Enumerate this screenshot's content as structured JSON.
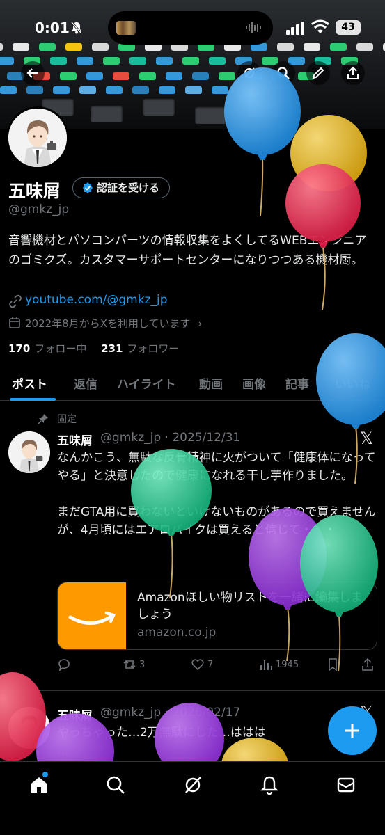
{
  "status_bar": {
    "time": "0:01",
    "battery": "43"
  },
  "header_actions": {
    "back_icon": "arrow-left-icon",
    "grok_icon": "grok-icon",
    "search_icon": "search-icon",
    "edit_icon": "pen-icon",
    "share_icon": "share-icon"
  },
  "profile": {
    "name": "五味屑",
    "verify_button": "認証を受ける",
    "handle": "@gmkz_jp",
    "bio": "音響機材とパソコンパーツの情報収集をよくしてるWEBエンジニアのゴミクズ。カスタマーサポートセンターになりつつある機材厨。",
    "link": "youtube.com/@gmkz_jp",
    "joined": "2022年8月からXを利用しています",
    "following_count": "170",
    "following_label": "フォロー中",
    "followers_count": "231",
    "followers_label": "フォロワー"
  },
  "tabs": [
    "ポスト",
    "返信",
    "ハイライト",
    "動画",
    "画像",
    "記事",
    "いいね"
  ],
  "posts": [
    {
      "pinned_label": "固定",
      "name": "五味屑",
      "handle": "@gmkz_jp",
      "date": "2025/12/31",
      "text": "なんかこう、無駄な反骨精神に火がついて「健康体になってやる」と決意したので健康になれる干し芋作りました。\n\nまだGTA用に買わないといけないものがあるので買えませんが、4月頃にはエアロバイクは買えると信じて・・・",
      "card": {
        "title": "Amazonほしい物リストを一緒に編集しましょう",
        "domain": "amazon.co.jp"
      },
      "stats": {
        "replies": "",
        "reposts": "3",
        "likes": "7",
        "views": "1945"
      }
    },
    {
      "name": "五味屑",
      "handle": "@gmkz_jp",
      "date": "2026/02/17",
      "text": "やっちゃった…2万無駄にした…ははは",
      "more": "…"
    }
  ],
  "colors": {
    "accent": "#1d9bf0",
    "background": "#000000",
    "muted": "#71767b",
    "amazon": "#ff9900"
  },
  "bottom_nav": [
    "home-icon",
    "search-icon",
    "grok-icon",
    "notifications-icon",
    "messages-icon"
  ]
}
